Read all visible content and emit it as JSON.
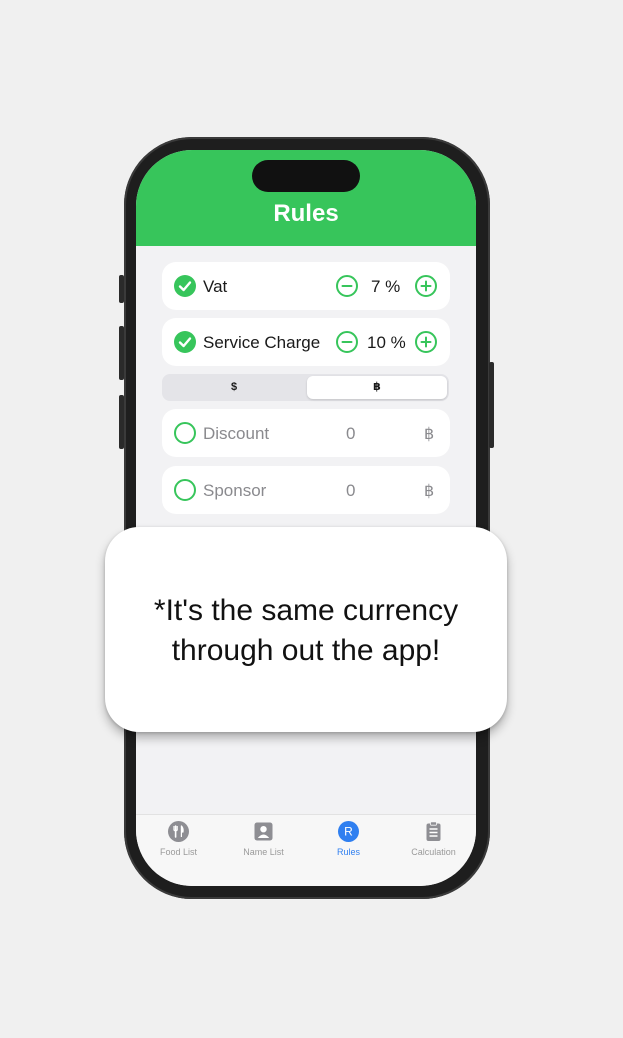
{
  "nav": {
    "title": "Rules"
  },
  "rules": [
    {
      "label": "Vat",
      "checked": true,
      "value": "7 %"
    },
    {
      "label": "Service Charge",
      "checked": true,
      "value": "10 %"
    }
  ],
  "currency_selector": {
    "options": [
      "$",
      "฿"
    ],
    "selected": "฿"
  },
  "adjustments": [
    {
      "label": "Discount",
      "checked": false,
      "amount": "0",
      "currency": "฿"
    },
    {
      "label": "Sponsor",
      "checked": false,
      "amount": "0",
      "currency": "฿"
    }
  ],
  "tabs": [
    {
      "label": "Food List",
      "icon": "fork-knife-icon"
    },
    {
      "label": "Name List",
      "icon": "person-card-icon"
    },
    {
      "label": "Rules",
      "icon": "rules-r-icon",
      "icon_letter": "R",
      "active": true
    },
    {
      "label": "Calculation",
      "icon": "clipboard-list-icon"
    }
  ],
  "callout": {
    "line1": "*It's the same currency",
    "line2": "through out the app!"
  },
  "colors": {
    "accent_green": "#37c55b",
    "active_tab_blue": "#2f7ff0"
  }
}
